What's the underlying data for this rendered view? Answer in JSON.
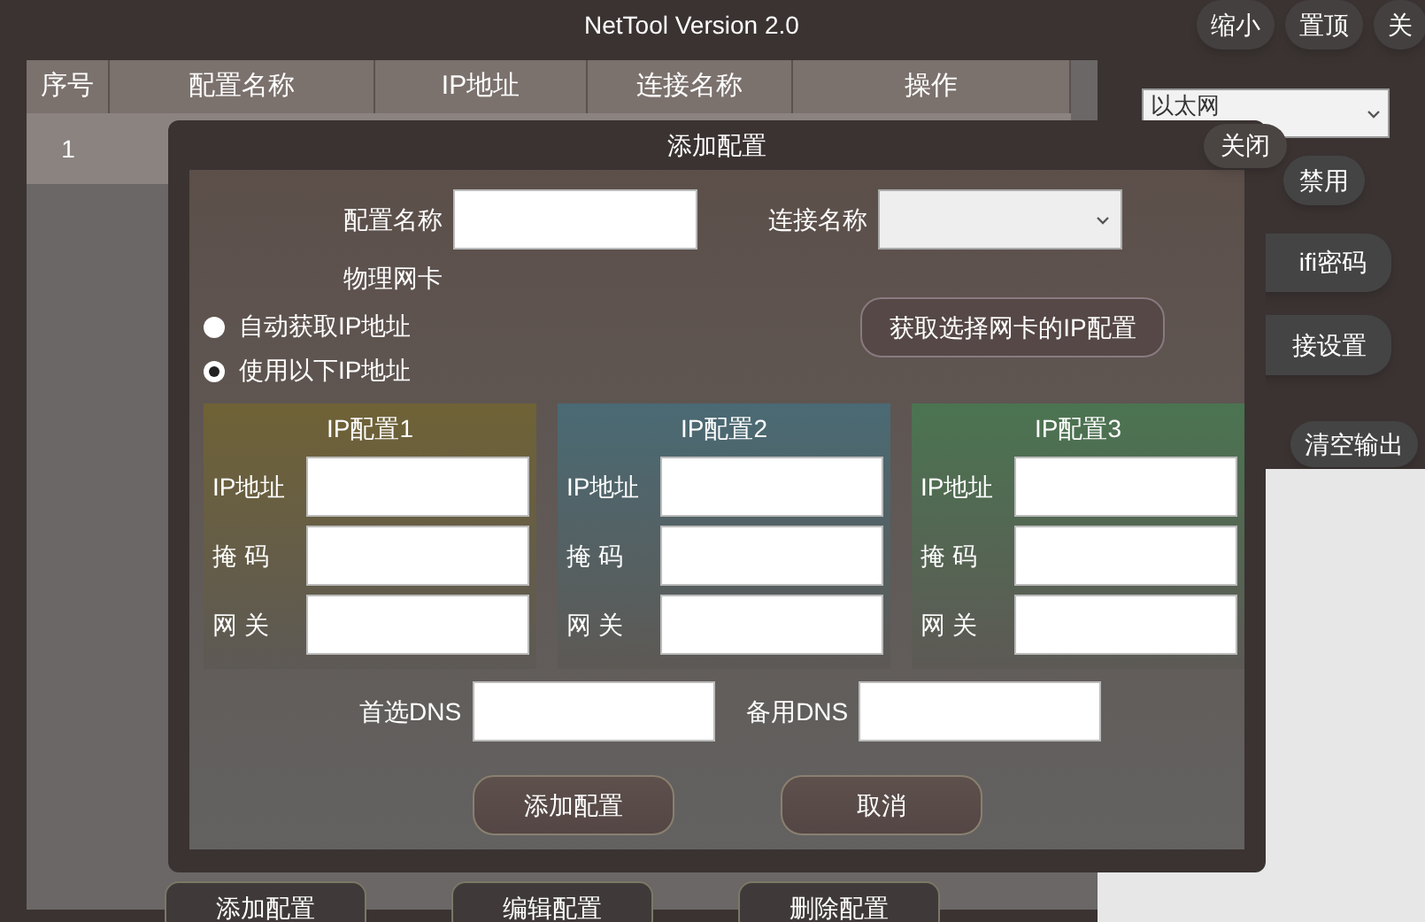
{
  "window": {
    "title": "NetTool Version 2.0"
  },
  "title_buttons": [
    "缩小",
    "置顶",
    "关"
  ],
  "table": {
    "columns": [
      "序号",
      "配置名称",
      "IP地址",
      "连接名称",
      "操作"
    ],
    "rows": [
      [
        "1"
      ]
    ]
  },
  "bottom_buttons": [
    "添加配置",
    "编辑配置",
    "删除配置"
  ],
  "side": {
    "adapter_select": "以太网",
    "buttons": [
      "禁用",
      "ifi密码",
      "接设置"
    ],
    "clear_button": "清空输出"
  },
  "dialog": {
    "title": "添加配置",
    "close": "关闭",
    "name_label": "配置名称",
    "connection_label": "连接名称",
    "adapter_label": "物理网卡",
    "radios": [
      {
        "label": "自动获取IP地址",
        "selected": false
      },
      {
        "label": "使用以下IP地址",
        "selected": true
      }
    ],
    "fetch_button": "获取选择网卡的IP配置",
    "ip_groups": [
      {
        "title": "IP配置1",
        "color": "#6f6236",
        "labels": [
          "IP地址",
          "掩 码",
          "网 关"
        ]
      },
      {
        "title": "IP配置2",
        "color": "#4a6a74",
        "labels": [
          "IP地址",
          "掩 码",
          "网 关"
        ]
      },
      {
        "title": "IP配置3",
        "color": "#4b7451",
        "labels": [
          "IP地址",
          "掩 码",
          "网 关"
        ]
      }
    ],
    "dns": [
      "首选DNS",
      "备用DNS"
    ],
    "buttons": [
      "添加配置",
      "取消"
    ]
  }
}
